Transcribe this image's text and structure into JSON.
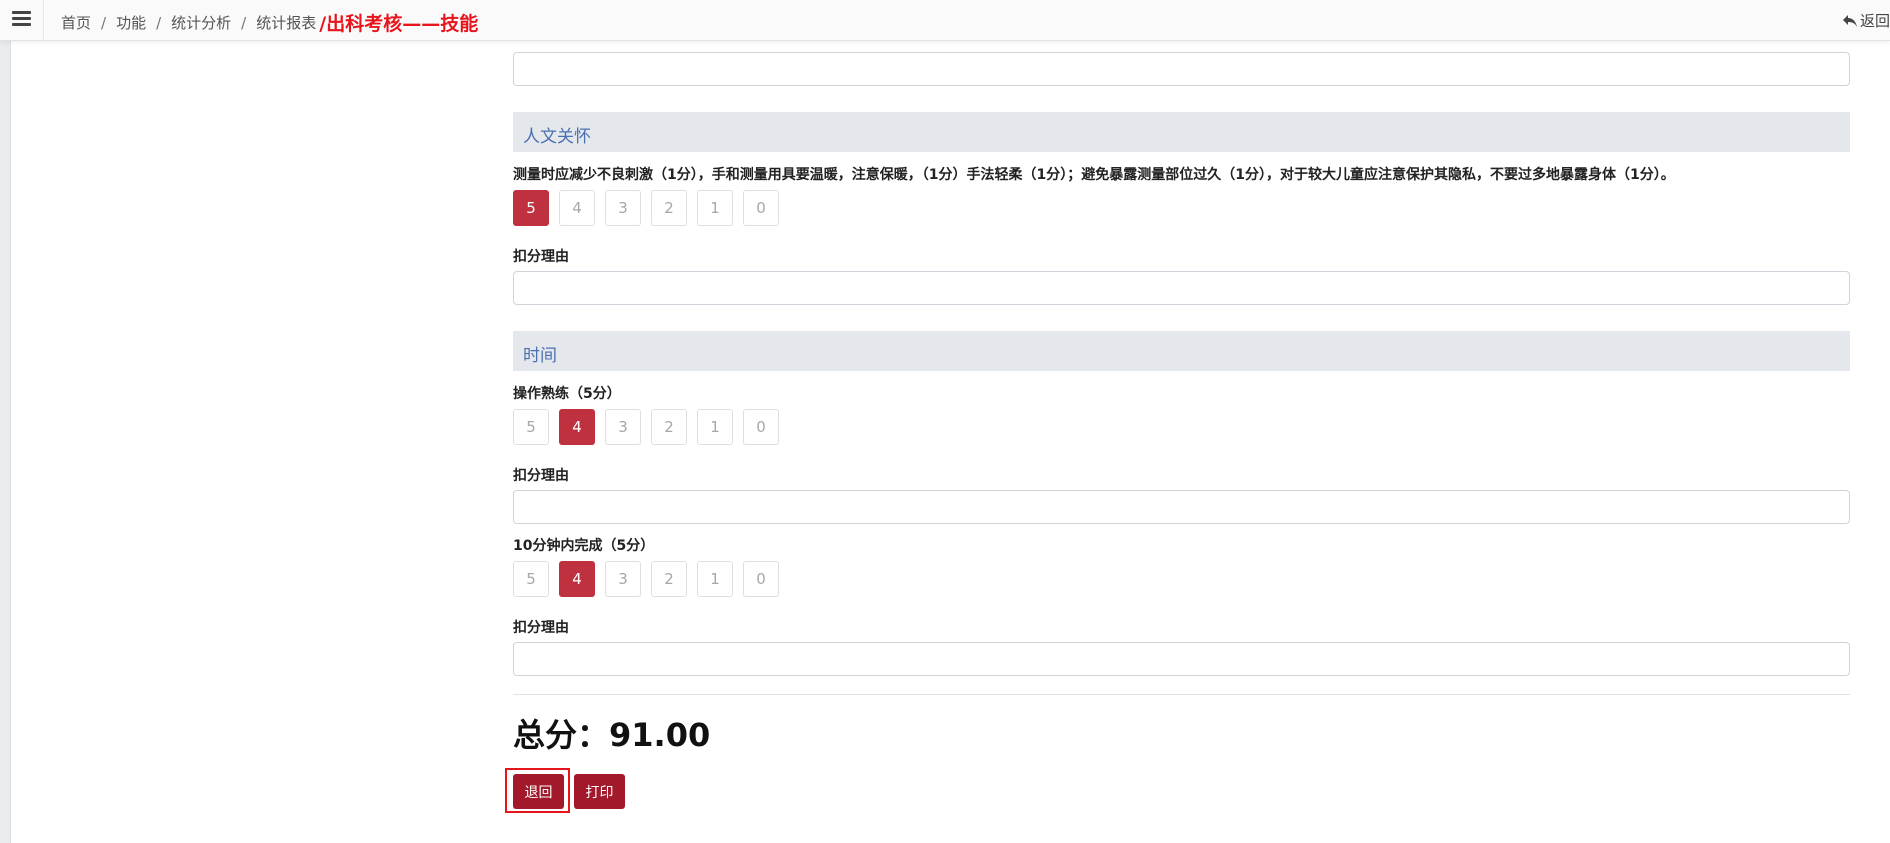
{
  "header": {
    "breadcrumb": [
      "首页",
      "功能",
      "统计分析",
      "统计报表"
    ],
    "separator": "/",
    "annotation": "/出科考核——技能",
    "return_label": "返回"
  },
  "sections": {
    "humanistic": {
      "title": "人文关怀",
      "criterion": "测量时应减少不良刺激（1分），手和测量用具要温暖，注意保暖，（1分）手法轻柔（1分）；避免暴露测量部位过久（1分），对于较大儿童应注意保护其隐私，不要过多地暴露身体（1分）。",
      "selected": 5,
      "reason_label": "扣分理由"
    },
    "time": {
      "title": "时间",
      "item1": {
        "label": "操作熟练（5分）",
        "selected": 4,
        "reason_label": "扣分理由"
      },
      "item2": {
        "label": "10分钟内完成（5分）",
        "selected": 4,
        "reason_label": "扣分理由"
      }
    }
  },
  "score_options": [
    "5",
    "4",
    "3",
    "2",
    "1",
    "0"
  ],
  "total": {
    "label": "总分：",
    "value": "91.00"
  },
  "buttons": {
    "back": "退回",
    "print": "打印"
  },
  "colors": {
    "selected": "#c0313f",
    "button": "#a1192b",
    "section_title": "#4a6fb0",
    "annotation": "#e8141b"
  }
}
